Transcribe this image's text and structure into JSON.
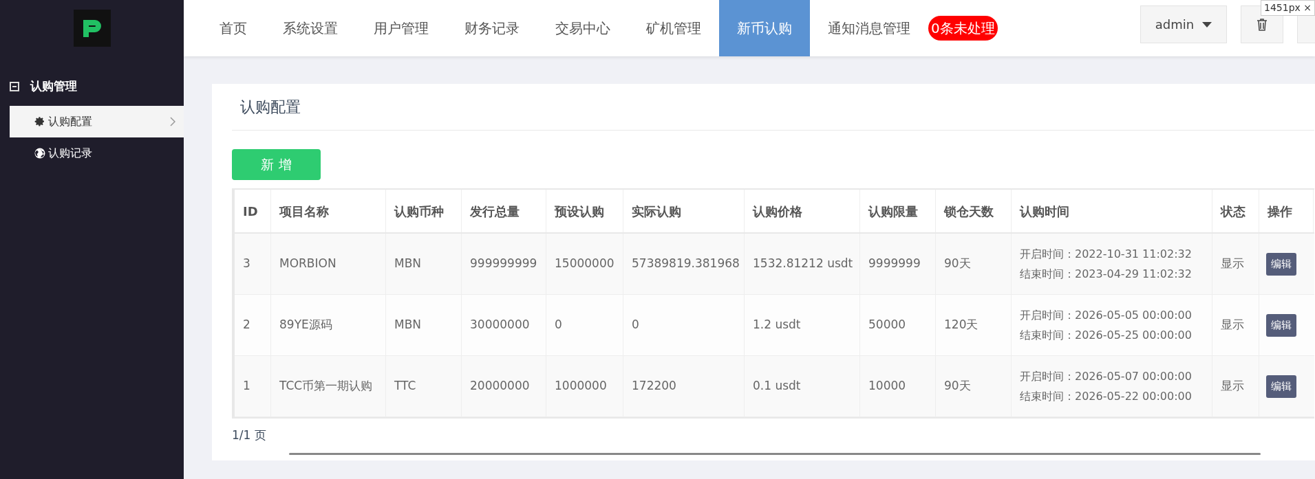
{
  "nav": [
    {
      "label": "首页",
      "selected": false
    },
    {
      "label": "系统设置",
      "selected": false
    },
    {
      "label": "用户管理",
      "selected": false
    },
    {
      "label": "财务记录",
      "selected": false
    },
    {
      "label": "交易中心",
      "selected": false
    },
    {
      "label": "矿机管理",
      "selected": false
    },
    {
      "label": "新币认购",
      "selected": true
    },
    {
      "label": "通知消息管理",
      "selected": false
    }
  ],
  "badge": "0条未处理",
  "user": "admin",
  "size_tooltip": "1451px ×",
  "sidebar": {
    "group": {
      "label": "认购管理",
      "expanded": true
    },
    "items": [
      {
        "label": "认购配置",
        "selected": true
      },
      {
        "label": "认购记录",
        "selected": false
      }
    ]
  },
  "page_title": "认购配置",
  "add_button": "新 增",
  "table": {
    "columns": [
      "ID",
      "项目名称",
      "认购币种",
      "发行总量",
      "预设认购",
      "实际认购",
      "认购价格",
      "认购限量",
      "锁仓天数",
      "认购时间",
      "状态",
      "操作"
    ],
    "rows": [
      {
        "cells": [
          "3",
          "MORBION",
          "MBN",
          "999999999",
          "15000000",
          "57389819.381968",
          "1532.81212 usdt",
          "9999999",
          "90天"
        ],
        "start": "开启时间：2022-10-31 11:02:32",
        "end": "结束时间：2023-04-29 11:02:32",
        "status": "显示",
        "action": "编辑"
      },
      {
        "cells": [
          "2",
          "89YE源码",
          "MBN",
          "30000000",
          "0",
          "0",
          "1.2 usdt",
          "50000",
          "120天"
        ],
        "start": "开启时间：2026-05-05 00:00:00",
        "end": "结束时间：2026-05-25 00:00:00",
        "status": "显示",
        "action": "编辑"
      },
      {
        "cells": [
          "1",
          "TCC币第一期认购",
          "TTC",
          "20000000",
          "1000000",
          "172200",
          "0.1 usdt",
          "10000",
          "90天"
        ],
        "start": "开启时间：2026-05-07 00:00:00",
        "end": "结束时间：2026-05-22 00:00:00",
        "status": "显示",
        "action": "编辑"
      }
    ]
  },
  "pagination": "1/1 页"
}
